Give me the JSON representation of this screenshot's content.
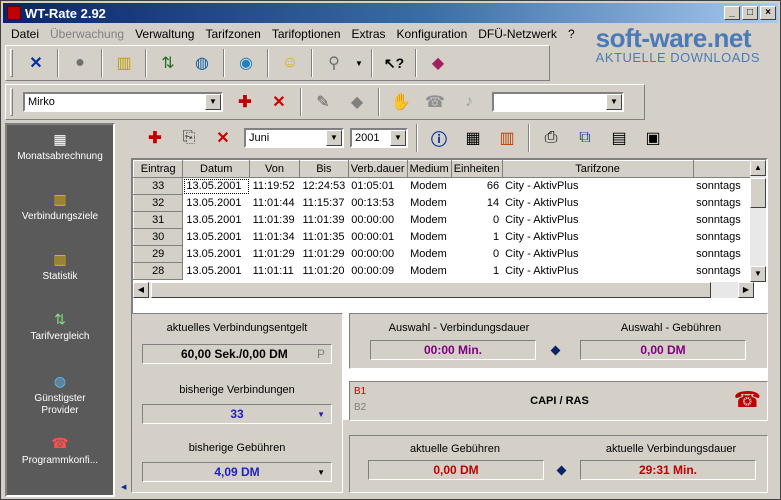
{
  "window": {
    "title": "WT-Rate 2.92"
  },
  "menu": [
    "Datei",
    "Überwachung",
    "Verwaltung",
    "Tarifzonen",
    "Tarifoptionen",
    "Extras",
    "Konfiguration",
    "DFÜ-Netzwerk",
    "?"
  ],
  "watermark": {
    "brand": "soft-ware.net",
    "tagline": "AKTUELLE DOWNLOADS"
  },
  "user_combo": {
    "value": "Mirko"
  },
  "filter": {
    "month": "Juni",
    "year": "2001"
  },
  "sidebar": {
    "items": [
      {
        "label": "Monatsabrechnung",
        "icon": "calculator-icon"
      },
      {
        "label": "Verbindungsziele",
        "icon": "bar-chart-icon"
      },
      {
        "label": "Statistik",
        "icon": "statistics-icon"
      },
      {
        "label": "Tarifvergleich",
        "icon": "compare-icon"
      },
      {
        "label": "Günstigster Provider",
        "icon": "globe-search-icon"
      },
      {
        "label": "Programmkonfi...",
        "icon": "phone-config-icon"
      }
    ]
  },
  "table": {
    "columns": [
      "Eintrag",
      "Datum",
      "Von",
      "Bis",
      "Verb.dauer",
      "Medium",
      "Einheiten",
      "Tarifzone",
      ""
    ],
    "rows": [
      [
        "33",
        "13.05.2001",
        "11:19:52",
        "12:24:53",
        "01:05:01",
        "Modem",
        "66",
        "City - AktivPlus",
        "sonntags"
      ],
      [
        "32",
        "13.05.2001",
        "11:01:44",
        "11:15:37",
        "00:13:53",
        "Modem",
        "14",
        "City - AktivPlus",
        "sonntags"
      ],
      [
        "31",
        "13.05.2001",
        "11:01:39",
        "11:01:39",
        "00:00:00",
        "Modem",
        "0",
        "City - AktivPlus",
        "sonntags"
      ],
      [
        "30",
        "13.05.2001",
        "11:01:34",
        "11:01:35",
        "00:00:01",
        "Modem",
        "1",
        "City - AktivPlus",
        "sonntags"
      ],
      [
        "29",
        "13.05.2001",
        "11:01:29",
        "11:01:29",
        "00:00:00",
        "Modem",
        "0",
        "City - AktivPlus",
        "sonntags"
      ],
      [
        "28",
        "13.05.2001",
        "11:01:11",
        "11:01:20",
        "00:00:09",
        "Modem",
        "1",
        "City - AktivPlus",
        "sonntags"
      ]
    ]
  },
  "left_panel": {
    "entgelt_label": "aktuelles Verbindungsentgelt",
    "entgelt_value": "60,00 Sek./0,00 DM",
    "entgelt_flag": "P",
    "verbindungen_label": "bisherige Verbindungen",
    "verbindungen_value": "33",
    "gebuehren_label": "bisherige Gebühren",
    "gebuehren_value": "4,09 DM"
  },
  "selection_panel": {
    "dauer_label": "Auswahl - Verbindungsdauer",
    "dauer_value": "00:00 Min.",
    "gebuehren_label": "Auswahl - Gebühren",
    "gebuehren_value": "0,00 DM"
  },
  "channel_panel": {
    "b1": "B1",
    "b2": "B2",
    "mode": "CAPI / RAS"
  },
  "current_panel": {
    "gebuehren_label": "aktuelle Gebühren",
    "gebuehren_value": "0,00 DM",
    "dauer_label": "aktuelle Verbindungsdauer",
    "dauer_value": "29:31 Min."
  },
  "colors": {
    "purple": "#800080",
    "red": "#c00000",
    "blue": "#0000c0",
    "sidebar": "#5a5a5a"
  }
}
